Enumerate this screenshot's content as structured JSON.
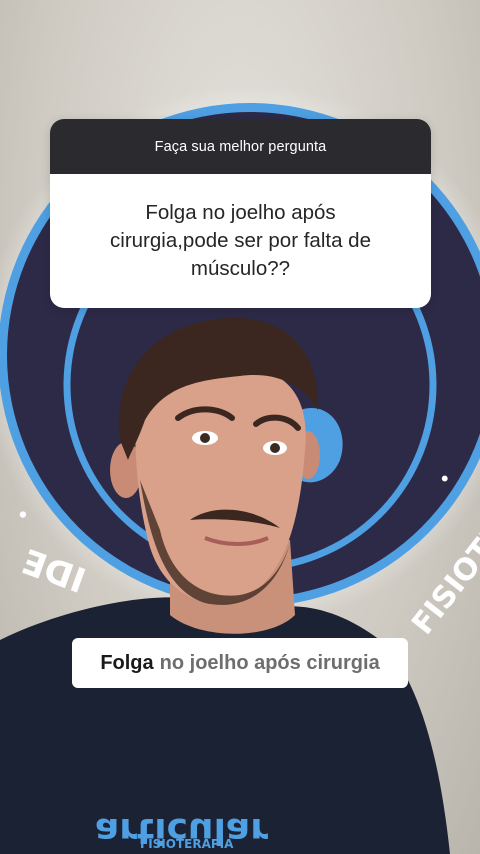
{
  "question_box": {
    "header": "Faça sua melhor pergunta",
    "question": "Folga no joelho após cirurgia,pode ser por falta de músculo??"
  },
  "caption": {
    "highlight": "Folga",
    "rest": "no joelho após cirurgia"
  },
  "background_logo": {
    "arc_text_left": "IDE",
    "arc_text_right": "FISIOTE",
    "shirt_text": "articular",
    "shirt_subtext": "FISIOTERAPIA"
  },
  "colors": {
    "logo_navy": "#2d2a47",
    "logo_blue": "#4f9fe3",
    "shirt": "#1b2233",
    "card_header": "#2b2b2f"
  }
}
